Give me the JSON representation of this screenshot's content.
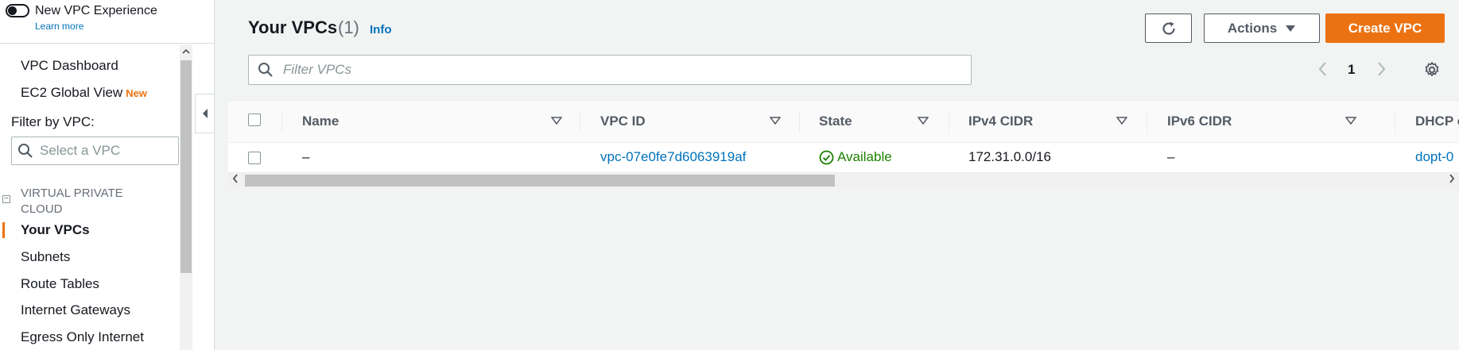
{
  "sidebar": {
    "toggle_label": "New VPC Experience",
    "learn_more": "Learn more",
    "items_top": [
      {
        "label": "VPC Dashboard"
      },
      {
        "label": "EC2 Global View",
        "badge": "New"
      }
    ],
    "filter_label": "Filter by VPC:",
    "filter_placeholder": "Select a VPC",
    "section_title": "VIRTUAL PRIVATE CLOUD",
    "section_toggle": "−",
    "items": [
      {
        "label": "Your VPCs",
        "active": true
      },
      {
        "label": "Subnets"
      },
      {
        "label": "Route Tables"
      },
      {
        "label": "Internet Gateways"
      },
      {
        "label": "Egress Only Internet"
      }
    ]
  },
  "header": {
    "title": "Your VPCs",
    "count": "(1)",
    "info": "Info",
    "actions_label": "Actions",
    "create_label": "Create VPC"
  },
  "filter": {
    "placeholder": "Filter VPCs"
  },
  "pagination": {
    "page": "1"
  },
  "table": {
    "columns": [
      "Name",
      "VPC ID",
      "State",
      "IPv4 CIDR",
      "IPv6 CIDR",
      "DHCP o"
    ],
    "rows": [
      {
        "name": "–",
        "vpc_id": "vpc-07e0fe7d6063919af",
        "state": "Available",
        "ipv4": "172.31.0.0/16",
        "ipv6": "–",
        "dhcp": "dopt-0"
      }
    ]
  },
  "colors": {
    "accent": "#ec7211",
    "link": "#0073bb",
    "success": "#1d8102"
  }
}
